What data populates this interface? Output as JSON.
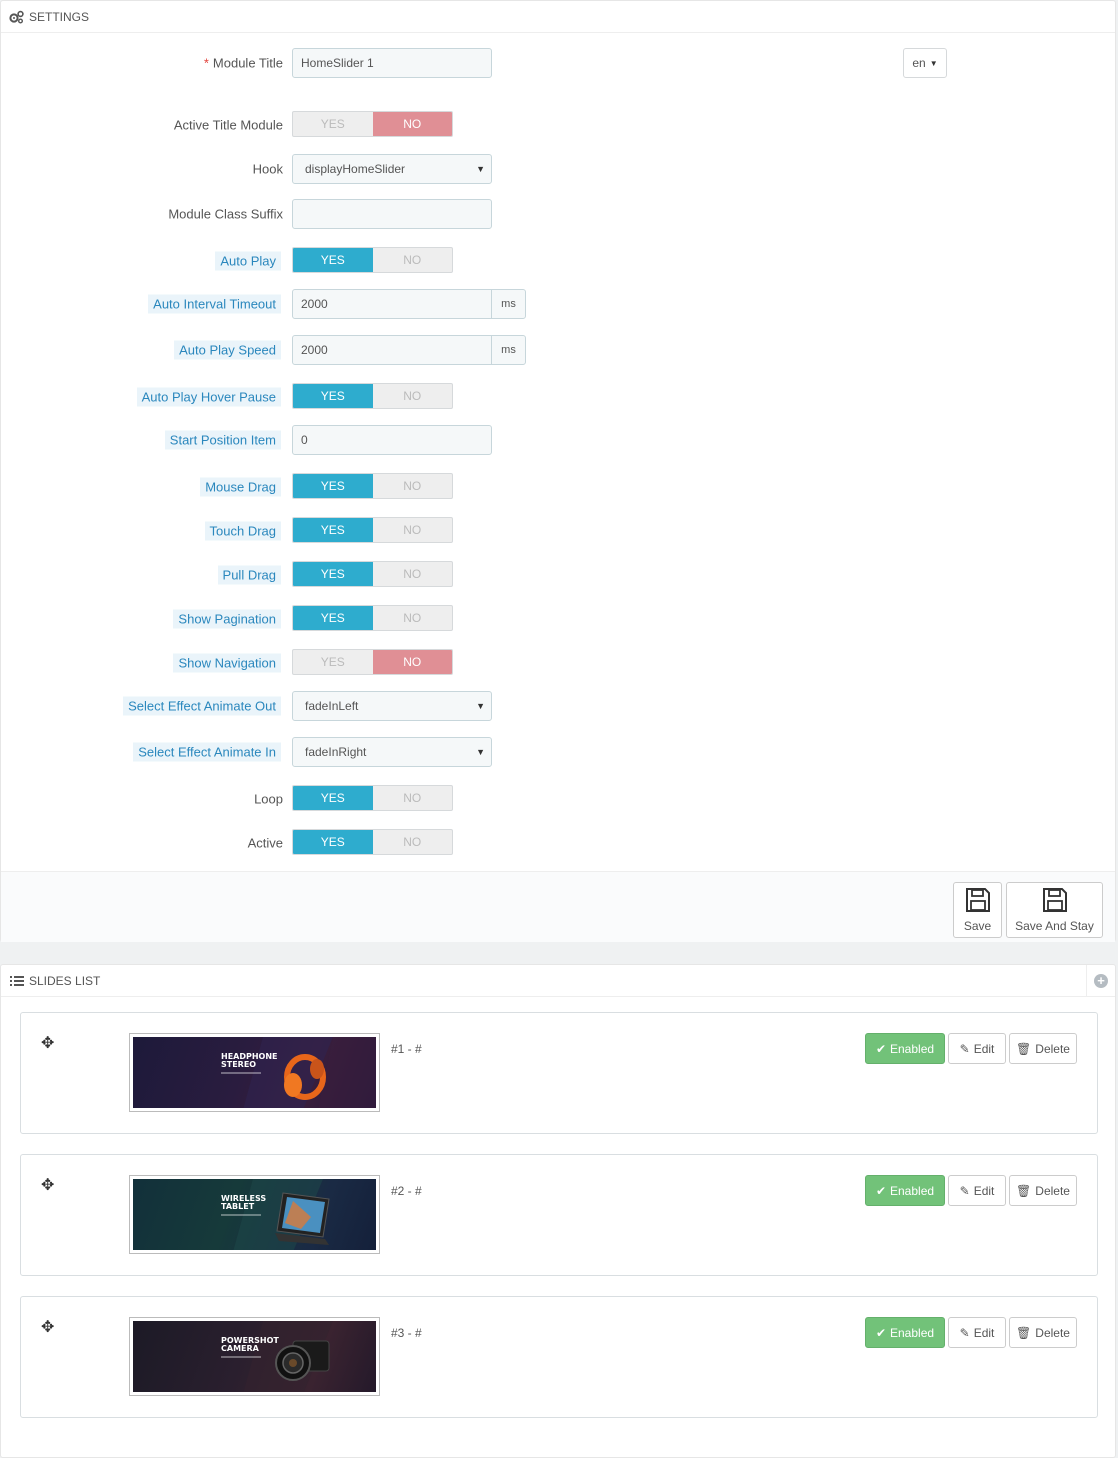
{
  "settings": {
    "heading": "SETTINGS",
    "module_title": {
      "label": "Module Title",
      "required": "*",
      "value": "HomeSlider 1",
      "lang": "en"
    },
    "active_title_module": {
      "label": "Active Title Module",
      "yes": "YES",
      "no": "NO",
      "value": "NO"
    },
    "hook": {
      "label": "Hook",
      "value": "displayHomeSlider"
    },
    "module_class_suffix": {
      "label": "Module Class Suffix",
      "value": ""
    },
    "auto_play": {
      "label": "Auto Play",
      "yes": "YES",
      "no": "NO",
      "value": "YES"
    },
    "auto_interval_timeout": {
      "label": "Auto Interval Timeout",
      "value": "2000",
      "unit": "ms"
    },
    "auto_play_speed": {
      "label": "Auto Play Speed",
      "value": "2000",
      "unit": "ms"
    },
    "auto_play_hover_pause": {
      "label": "Auto Play Hover Pause",
      "yes": "YES",
      "no": "NO",
      "value": "YES"
    },
    "start_position_item": {
      "label": "Start Position Item",
      "value": "0"
    },
    "mouse_drag": {
      "label": "Mouse Drag",
      "yes": "YES",
      "no": "NO",
      "value": "YES"
    },
    "touch_drag": {
      "label": "Touch Drag",
      "yes": "YES",
      "no": "NO",
      "value": "YES"
    },
    "pull_drag": {
      "label": "Pull Drag",
      "yes": "YES",
      "no": "NO",
      "value": "YES"
    },
    "show_pagination": {
      "label": "Show Pagination",
      "yes": "YES",
      "no": "NO",
      "value": "YES"
    },
    "show_navigation": {
      "label": "Show Navigation",
      "yes": "YES",
      "no": "NO",
      "value": "NO"
    },
    "animate_out": {
      "label": "Select Effect Animate Out",
      "value": "fadeInLeft"
    },
    "animate_in": {
      "label": "Select Effect Animate In",
      "value": "fadeInRight"
    },
    "loop": {
      "label": "Loop",
      "yes": "YES",
      "no": "NO",
      "value": "YES"
    },
    "active": {
      "label": "Active",
      "yes": "YES",
      "no": "NO",
      "value": "YES"
    },
    "save_label": "Save",
    "save_stay_label": "Save And Stay"
  },
  "slides": {
    "heading": "SLIDES LIST",
    "items": [
      {
        "index": "#1 - #",
        "banner_line1": "HEADPHONE",
        "banner_line2": "STEREO",
        "status": "Enabled",
        "edit": "Edit",
        "delete": "Delete"
      },
      {
        "index": "#2 - #",
        "banner_line1": "WIRELESS",
        "banner_line2": "TABLET",
        "status": "Enabled",
        "edit": "Edit",
        "delete": "Delete"
      },
      {
        "index": "#3 - #",
        "banner_line1": "POWERSHOT",
        "banner_line2": "CAMERA",
        "status": "Enabled",
        "edit": "Edit",
        "delete": "Delete"
      }
    ]
  },
  "colors": {
    "switch_yes": "#2eacce",
    "switch_no": "#e08f95",
    "enabled_button": "#72c279",
    "hint_label": "#2a87bd"
  },
  "icons": {
    "settings": "cogs-icon",
    "slides": "list-icon",
    "save": "floppy-disk-icon",
    "add": "plus-circle-icon",
    "move": "move-arrows-icon",
    "enabled": "check-icon",
    "edit": "pencil-square-icon",
    "delete": "trash-icon"
  }
}
